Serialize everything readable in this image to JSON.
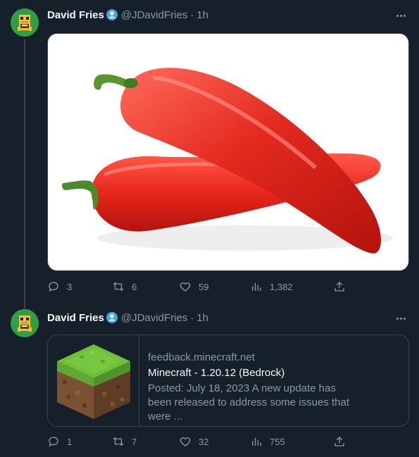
{
  "tweets": [
    {
      "author": "David Fries",
      "handle": "@JDavidFries",
      "separator": "·",
      "time": "1h",
      "media": {
        "type": "image",
        "subject": "red peppers"
      },
      "stats": {
        "replies": "3",
        "retweets": "6",
        "likes": "59",
        "views": "1,382"
      }
    },
    {
      "author": "David Fries",
      "handle": "@JDavidFries",
      "separator": "·",
      "time": "1h",
      "card": {
        "domain": "feedback.minecraft.net",
        "title": "Minecraft - 1.20.12 (Bedrock)",
        "description": "Posted: July 18, 2023 A new update has been released to address some issues that were ..."
      },
      "stats": {
        "replies": "1",
        "retweets": "7",
        "likes": "32",
        "views": "755"
      }
    }
  ],
  "icons": {
    "reply": "reply-icon",
    "retweet": "retweet-icon",
    "like": "heart-icon",
    "views": "views-icon",
    "share": "share-icon",
    "more": "more-icon",
    "verified": "verified-badge-icon"
  },
  "colors": {
    "background": "#15202b",
    "border": "#38444d",
    "text": "#f7f9f9",
    "secondary": "#8b98a5",
    "avatar": "#2f9e44",
    "pepper": "#e8261c"
  }
}
